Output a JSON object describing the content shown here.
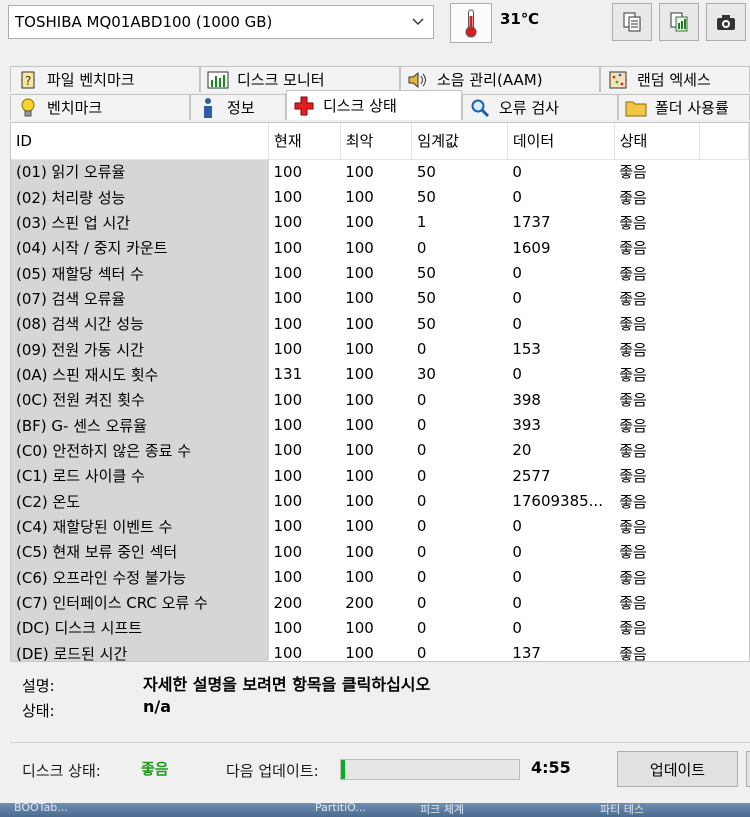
{
  "drive": {
    "name": "TOSHIBA MQ01ABD100 (1000 GB)"
  },
  "temperature": {
    "value": "31℃"
  },
  "tabs_row1": [
    {
      "label": "파일 벤치마크",
      "icon": "file-benchmark-icon"
    },
    {
      "label": "디스크 모니터",
      "icon": "disk-monitor-icon"
    },
    {
      "label": "소음 관리(AAM)",
      "icon": "speaker-icon"
    },
    {
      "label": "랜덤 엑세스",
      "icon": "random-access-icon"
    }
  ],
  "tabs_row2": [
    {
      "label": "벤치마크",
      "icon": "lightbulb-icon"
    },
    {
      "label": "정보",
      "icon": "info-icon"
    },
    {
      "label": "디스크 상태",
      "icon": "red-cross-icon",
      "active": true
    },
    {
      "label": "오류 검사",
      "icon": "magnifier-icon"
    },
    {
      "label": "폴더 사용률",
      "icon": "folder-icon"
    }
  ],
  "table": {
    "headers": [
      "ID",
      "현재",
      "최악",
      "임계값",
      "데이터",
      "상태"
    ],
    "rows": [
      [
        "(01) 읽기 오류율",
        "100",
        "100",
        "50",
        "0",
        "좋음"
      ],
      [
        "(02) 처리량 성능",
        "100",
        "100",
        "50",
        "0",
        "좋음"
      ],
      [
        "(03) 스핀 업 시간",
        "100",
        "100",
        "1",
        "1737",
        "좋음"
      ],
      [
        "(04) 시작 / 중지 카운트",
        "100",
        "100",
        "0",
        "1609",
        "좋음"
      ],
      [
        "(05) 재할당 섹터 수",
        "100",
        "100",
        "50",
        "0",
        "좋음"
      ],
      [
        "(07) 검색 오류율",
        "100",
        "100",
        "50",
        "0",
        "좋음"
      ],
      [
        "(08) 검색 시간 성능",
        "100",
        "100",
        "50",
        "0",
        "좋음"
      ],
      [
        "(09) 전원 가동 시간",
        "100",
        "100",
        "0",
        "153",
        "좋음"
      ],
      [
        "(0A) 스핀 재시도 횟수",
        "131",
        "100",
        "30",
        "0",
        "좋음"
      ],
      [
        "(0C) 전원 켜진 횟수",
        "100",
        "100",
        "0",
        "398",
        "좋음"
      ],
      [
        "(BF) G- 센스 오류율",
        "100",
        "100",
        "0",
        "393",
        "좋음"
      ],
      [
        "(C0) 안전하지 않은 종료 수",
        "100",
        "100",
        "0",
        "20",
        "좋음"
      ],
      [
        "(C1) 로드 사이클 수",
        "100",
        "100",
        "0",
        "2577",
        "좋음"
      ],
      [
        "(C2) 온도",
        "100",
        "100",
        "0",
        "17609385...",
        "좋음"
      ],
      [
        "(C4) 재할당된 이벤트 수",
        "100",
        "100",
        "0",
        "0",
        "좋음"
      ],
      [
        "(C5) 현재 보류 중인 섹터",
        "100",
        "100",
        "0",
        "0",
        "좋음"
      ],
      [
        "(C6) 오프라인 수정 불가능",
        "100",
        "100",
        "0",
        "0",
        "좋음"
      ],
      [
        "(C7) 인터페이스 CRC 오류 수",
        "200",
        "200",
        "0",
        "0",
        "좋음"
      ],
      [
        "(DC) 디스크 시프트",
        "100",
        "100",
        "0",
        "0",
        "좋음"
      ],
      [
        "(DE) 로드된 시간",
        "100",
        "100",
        "0",
        "137",
        "좋음"
      ]
    ]
  },
  "description": {
    "label": "설명:",
    "text": "자세한 설명을 보려면 항목을 클릭하십시오",
    "status_label": "상태:",
    "status_value": "n/a"
  },
  "bottom": {
    "disk_status_label": "디스크 상태:",
    "disk_status_value": "좋음",
    "next_update_label": "다음 업데이트:",
    "progress": 0.02,
    "time": "4:55",
    "update_button": "업데이트"
  },
  "taskbar": [
    "BOOTab...",
    "PartitiO...",
    "피크 체계",
    "파티 테스"
  ],
  "colors": {
    "good": "#1e9c1e",
    "progress": "#06b025",
    "id_column_bg": "#d6d6d6"
  }
}
